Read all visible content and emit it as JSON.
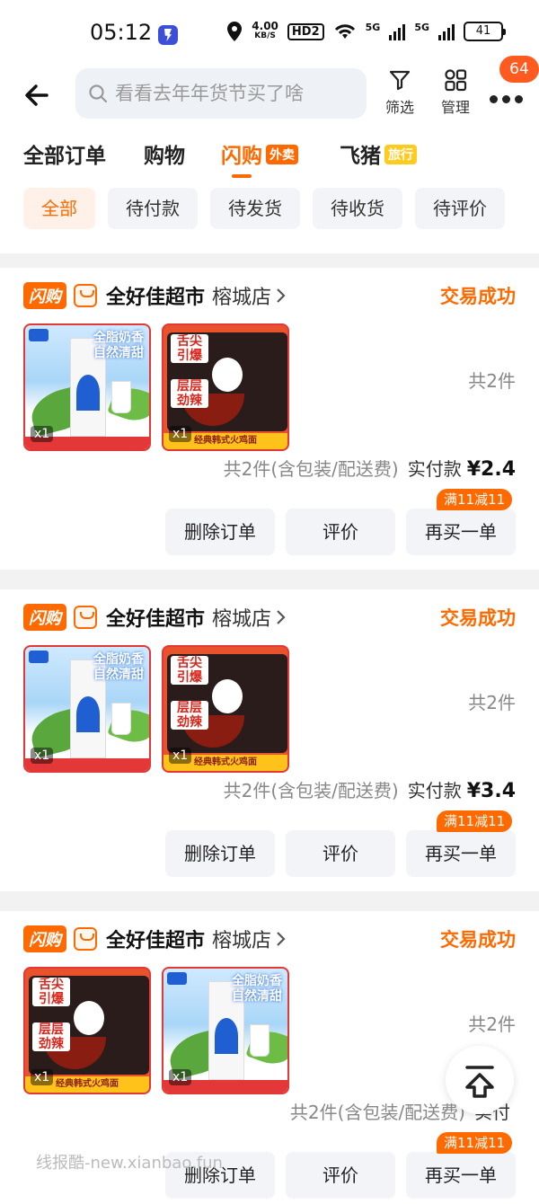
{
  "status_bar": {
    "time": "05:12",
    "speed_value": "4.00",
    "speed_unit": "KB/S",
    "hd": "HD2",
    "net1": "5G",
    "net2": "5G",
    "battery": "41"
  },
  "header": {
    "search_placeholder": "看看去年年货节买了啥",
    "filter_label": "筛选",
    "manage_label": "管理",
    "message_badge": "64"
  },
  "tabs": [
    {
      "label": "全部订单"
    },
    {
      "label": "购物"
    },
    {
      "label": "闪购",
      "tag": "外卖"
    },
    {
      "label": "飞猪",
      "tag": "旅行"
    }
  ],
  "filters": [
    "全部",
    "待付款",
    "待发货",
    "待收货",
    "待评价"
  ],
  "colors": {
    "accent": "#ff6a00",
    "chip_bg": "#f2f4f7",
    "page_bg": "#f2f2f2"
  },
  "orders": [
    {
      "badge": "闪购",
      "store": "全好佳超市",
      "branch": "榕城店",
      "status": "交易成功",
      "products": [
        {
          "kind": "milk",
          "tagline": "全脂奶香\n自然清甜",
          "qty": "x1"
        },
        {
          "kind": "noodle",
          "slogan1": "舌尖\n引爆",
          "slogan2": "层层\n劲辣",
          "strip": "经典韩式火鸡面",
          "qty": "x1"
        }
      ],
      "count": "共2件",
      "summary": "共2件(含包装/配送费)",
      "paid_label": "实付款",
      "price": "¥2.4",
      "buttons": [
        "删除订单",
        "评价",
        "再买一单"
      ],
      "promo": "满11减11"
    },
    {
      "badge": "闪购",
      "store": "全好佳超市",
      "branch": "榕城店",
      "status": "交易成功",
      "products": [
        {
          "kind": "milk",
          "tagline": "全脂奶香\n自然清甜",
          "qty": "x1"
        },
        {
          "kind": "noodle",
          "slogan1": "舌尖\n引爆",
          "slogan2": "层层\n劲辣",
          "strip": "经典韩式火鸡面",
          "qty": "x1"
        }
      ],
      "count": "共2件",
      "summary": "共2件(含包装/配送费)",
      "paid_label": "实付款",
      "price": "¥3.4",
      "buttons": [
        "删除订单",
        "评价",
        "再买一单"
      ],
      "promo": "满11减11"
    },
    {
      "badge": "闪购",
      "store": "全好佳超市",
      "branch": "榕城店",
      "status": "交易成功",
      "products": [
        {
          "kind": "noodle",
          "slogan1": "舌尖\n引爆",
          "slogan2": "层层\n劲辣",
          "strip": "经典韩式火鸡面",
          "qty": "x1"
        },
        {
          "kind": "milk",
          "tagline": "全脂奶香\n自然清甜",
          "qty": "x1"
        }
      ],
      "count": "共2件",
      "summary": "共2件(含包装/配送费)",
      "paid_label": "实付",
      "price": "",
      "buttons": [
        "删除订单",
        "评价",
        "再买一单"
      ],
      "promo": "满11减11"
    }
  ],
  "watermark": "线报酷-new.xianbao.fun"
}
